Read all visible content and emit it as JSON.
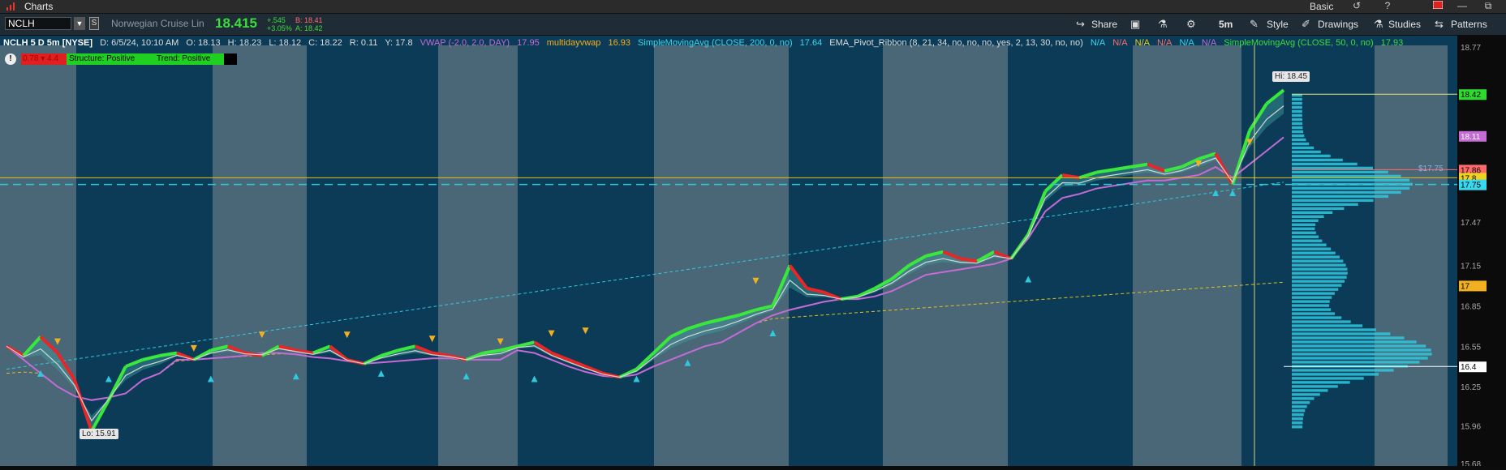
{
  "window": {
    "title": "Charts",
    "mode": "Basic",
    "history_icon": "history-icon",
    "help_label": "?"
  },
  "toolbar": {
    "symbol": "NCLH",
    "symbol_dropdown": "▼",
    "symbol_badge": "S",
    "company": "Norwegian Cruise Lin",
    "last": "18.415",
    "change": "+.545",
    "change_pct": "+3.05%",
    "bid": "B: 18.41",
    "ask": "A: 18.42",
    "share": "Share",
    "timeframe": "5m",
    "style": "Style",
    "drawings": "Drawings",
    "studies": "Studies",
    "patterns": "Patterns"
  },
  "infobar": {
    "symbol": "NCLH 5 D 5m [NYSE]",
    "date": "D: 6/5/24, 10:10 AM",
    "open": "O: 18.13",
    "high": "H: 18.23",
    "low": "L: 18.12",
    "close": "C: 18.22",
    "range": "R: 0.11",
    "y": "Y: 17.8",
    "vwap": "VWAP (-2.0, 2.0, DAY)",
    "vwap_val": "17.95",
    "mdv": "multidayvwap",
    "mdv_val": "16.93",
    "sma200": "SimpleMovingAvg (CLOSE, 200, 0, no)",
    "sma200_val": "17.64",
    "ema": "EMA_Pivot_Ribbon (8, 21, 34, no, no, no, yes, 2, 13, 30, no, no)",
    "na": [
      "N/A",
      "N/A",
      "N/A",
      "N/A",
      "N/A",
      "N/A"
    ],
    "sma50": "SimpleMovingAvg (CLOSE, 50, 0, no)",
    "sma50_val": "17.93"
  },
  "status": {
    "alert": "!",
    "badge_red": "0.78 ▾ 4.4",
    "structure": "Structure: Positive",
    "trend": "Trend: Positive"
  },
  "labels": {
    "hi": "Hi: 18.45",
    "lo": "Lo: 15.91",
    "vp_price": "$17.75"
  },
  "price_axis": {
    "ticks": [
      "18.77",
      "18.42",
      "18.11",
      "17.86",
      "17.8",
      "17.75",
      "17.47",
      "17.15",
      "17",
      "16.85",
      "16.55",
      "16.4",
      "16.25",
      "15.96",
      "15.68"
    ],
    "tick_values": [
      18.77,
      18.42,
      18.11,
      17.86,
      17.8,
      17.75,
      17.47,
      17.15,
      17.0,
      16.85,
      16.55,
      16.4,
      16.25,
      15.96,
      15.68
    ],
    "tick_bg": [
      "",
      "#2edc2e",
      "#c46bd6",
      "#ff6b6b",
      "#f0d020",
      "#38d8ee",
      "",
      "",
      "#f0b020",
      "",
      "",
      "#ffffff",
      "",
      "",
      ""
    ],
    "tick_fg": [
      "#aaa",
      "#000",
      "#fff",
      "#000",
      "#000",
      "#000",
      "#aaa",
      "#aaa",
      "#000",
      "#aaa",
      "#aaa",
      "#000",
      "#aaa",
      "#aaa",
      "#aaa"
    ]
  },
  "colors": {
    "bg": "#0c3b57",
    "band": "#56707e",
    "bull": "#38e83a",
    "bear": "#e82626",
    "vwap": "#c46bd6",
    "sma": "#d6d6d6",
    "cyan": "#2fc9de",
    "yellow": "#e0c020"
  },
  "chart_data": {
    "type": "line",
    "title": "NCLH 5 D 5m [NYSE]",
    "ylim": [
      15.68,
      18.77
    ],
    "series": [
      {
        "name": "NCLH",
        "values": [
          16.55,
          16.48,
          16.62,
          16.5,
          16.3,
          15.92,
          16.15,
          16.4,
          16.45,
          16.48,
          16.5,
          16.45,
          16.52,
          16.55,
          16.5,
          16.48,
          16.55,
          16.52,
          16.5,
          16.55,
          16.45,
          16.42,
          16.48,
          16.52,
          16.55,
          16.5,
          16.48,
          16.45,
          16.5,
          16.52,
          16.55,
          16.58,
          16.5,
          16.45,
          16.4,
          16.35,
          16.32,
          16.38,
          16.5,
          16.62,
          16.68,
          16.72,
          16.75,
          16.78,
          16.82,
          16.85,
          17.15,
          16.98,
          16.95,
          16.9,
          16.92,
          16.98,
          17.05,
          17.15,
          17.22,
          17.25,
          17.2,
          17.18,
          17.25,
          17.2,
          17.38,
          17.7,
          17.82,
          17.8,
          17.84,
          17.86,
          17.88,
          17.9,
          17.85,
          17.88,
          17.94,
          17.98,
          17.75,
          18.15,
          18.35,
          18.45
        ]
      },
      {
        "name": "VWAP",
        "values": [
          16.55,
          16.45,
          16.35,
          16.25,
          16.18,
          16.15,
          16.17,
          16.2,
          16.3,
          16.35,
          16.45,
          16.45,
          16.46,
          16.47,
          16.48,
          16.5,
          16.5,
          16.49,
          16.47,
          16.46,
          16.44,
          16.42,
          16.43,
          16.44,
          16.45,
          16.46,
          16.46,
          16.45,
          16.45,
          16.45,
          16.52,
          16.5,
          16.45,
          16.4,
          16.36,
          16.33,
          16.32,
          16.34,
          16.4,
          16.45,
          16.5,
          16.55,
          16.58,
          16.65,
          16.72,
          16.78,
          16.82,
          16.85,
          16.88,
          16.9,
          16.9,
          16.92,
          16.96,
          17.02,
          17.08,
          17.1,
          17.12,
          17.14,
          17.16,
          17.2,
          17.35,
          17.55,
          17.65,
          17.68,
          17.72,
          17.74,
          17.76,
          17.78,
          17.78,
          17.8,
          17.82,
          17.88,
          17.8,
          17.9,
          18.0,
          18.1
        ]
      }
    ],
    "events_up": [
      16.42,
      16.38,
      16.38,
      16.4,
      16.42,
      16.4,
      16.38,
      16.38,
      16.5,
      16.72,
      17.12,
      17.76,
      17.76
    ],
    "events_down": [
      16.5,
      16.45,
      16.55,
      16.55,
      16.52,
      16.5,
      16.56,
      16.58,
      16.95,
      17.82,
      17.98
    ]
  }
}
